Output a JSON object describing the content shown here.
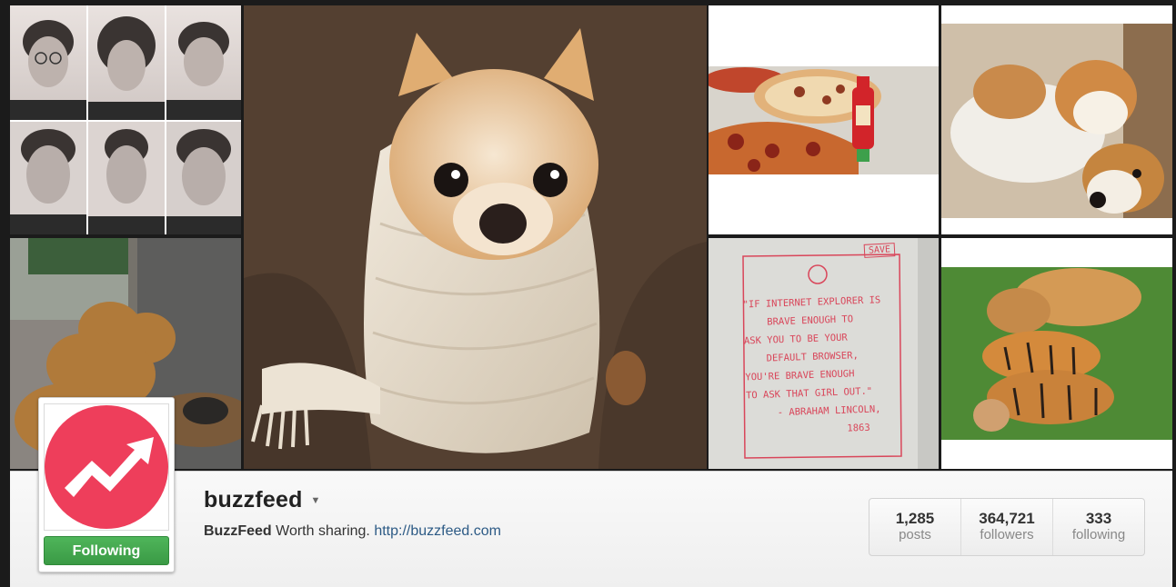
{
  "profile": {
    "username": "buzzfeed",
    "full_name": "BuzzFeed",
    "bio": "Worth sharing.",
    "website": "http://buzzfeed.com",
    "follow_button_label": "Following",
    "avatar_icon": "buzzfeed-trending-arrow-logo",
    "brand_color": "#ee3e5b",
    "follow_color": "#3ea849"
  },
  "stats": [
    {
      "value": "1,285",
      "label": "posts"
    },
    {
      "value": "364,721",
      "label": "followers"
    },
    {
      "value": "333",
      "label": "following"
    }
  ],
  "whiteboard": {
    "tag": "SAVE",
    "lines": [
      "\"If Internet Explorer is",
      "brave enough to",
      "ask you to be your",
      "default browser,",
      "you're brave enough",
      "to ask that girl out.\"",
      "- Abraham Lincoln,",
      "1863"
    ]
  }
}
